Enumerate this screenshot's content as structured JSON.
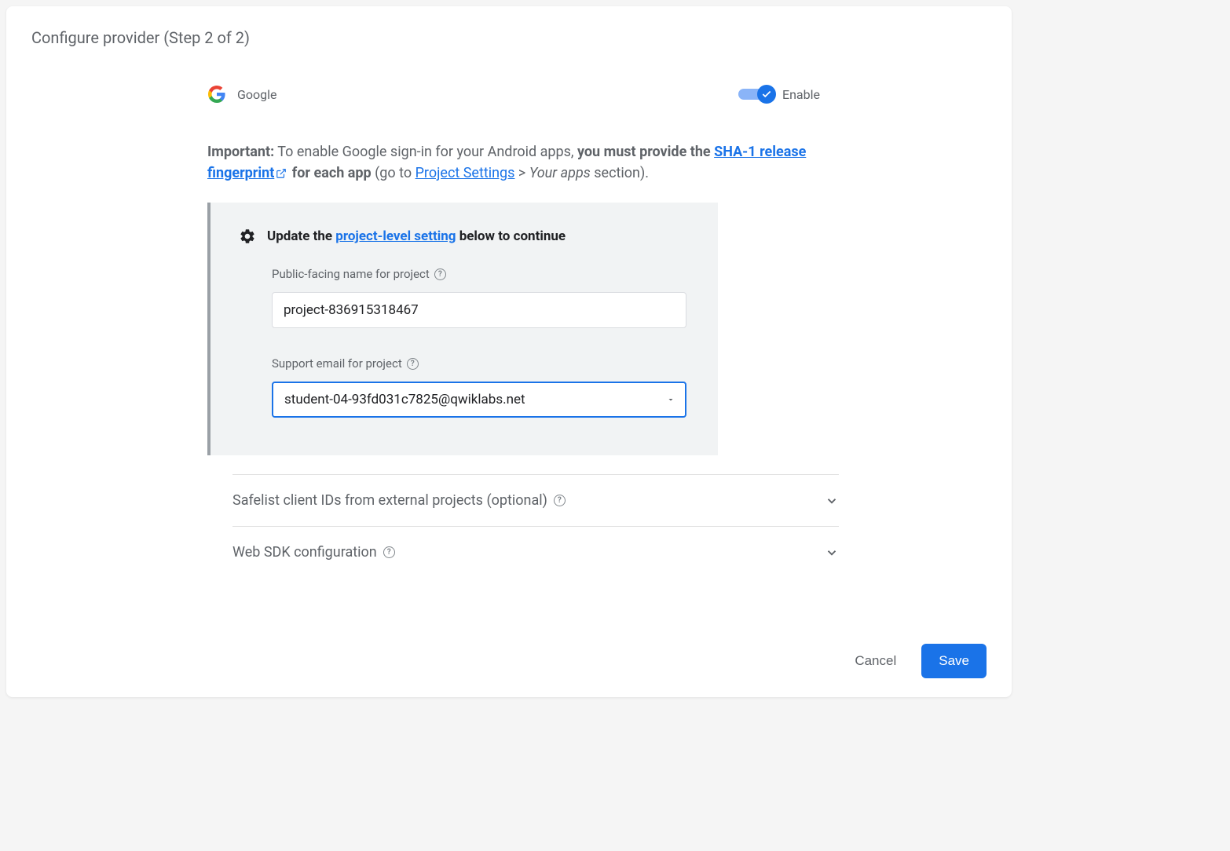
{
  "dialog": {
    "title": "Configure provider (Step 2 of 2)"
  },
  "provider": {
    "name": "Google",
    "toggle_label": "Enable"
  },
  "important": {
    "prefix": "Important:",
    "text1": " To enable Google sign-in for your Android apps, ",
    "bold1": "you must provide the ",
    "link1": "SHA-1 release fingerprint",
    "bold2": " for each app",
    "text2": " (go to ",
    "link2": "Project Settings",
    "text3": " > ",
    "italic1": "Your apps",
    "text4": " section)."
  },
  "settings": {
    "header_pre": "Update the ",
    "header_link": "project-level setting",
    "header_post": " below to continue",
    "name_label": "Public-facing name for project",
    "name_value": "project-836915318467",
    "email_label": "Support email for project",
    "email_value": "student-04-93fd031c7825@qwiklabs.net"
  },
  "collapsibles": {
    "safelist": "Safelist client IDs from external projects (optional)",
    "websdk": "Web SDK configuration"
  },
  "footer": {
    "cancel": "Cancel",
    "save": "Save"
  }
}
